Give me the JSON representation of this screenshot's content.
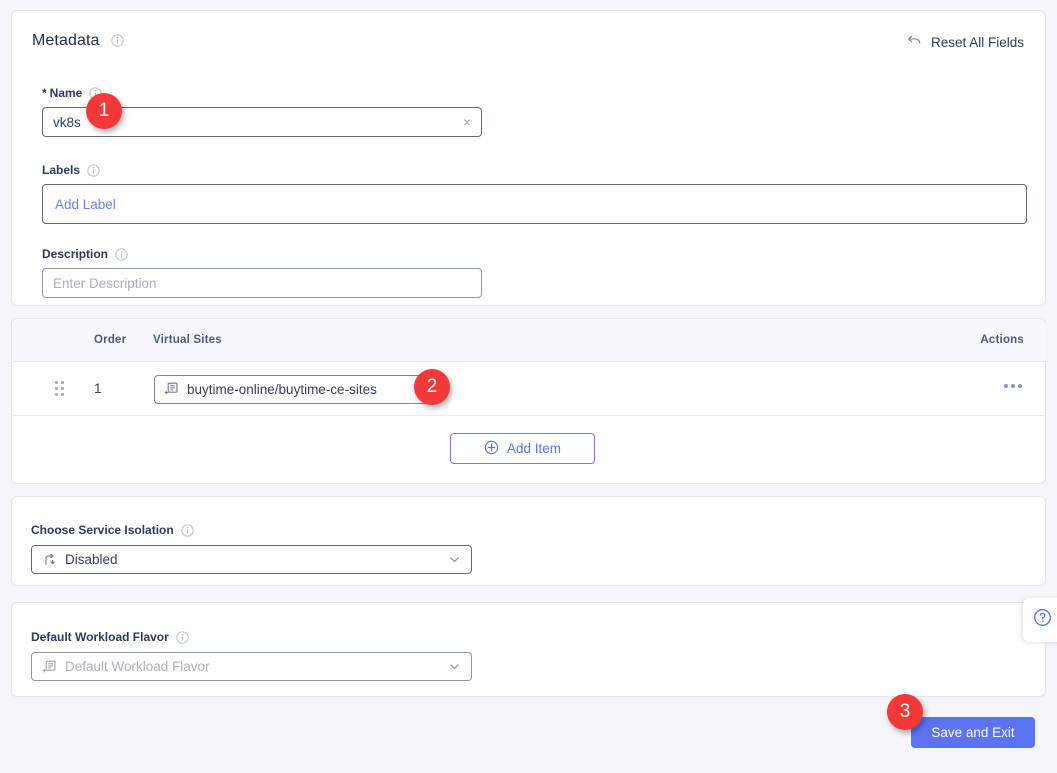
{
  "metadata_card": {
    "title": "Metadata",
    "reset_label": "Reset All Fields",
    "name_label": "Name",
    "name_required_mark": "*",
    "name_value": "vk8s",
    "name_clear_icon": "×",
    "labels_label": "Labels",
    "labels_add_text": "Add Label",
    "description_label": "Description",
    "description_placeholder": "Enter Description"
  },
  "sites_card": {
    "columns": [
      "Order",
      "Virtual Sites",
      "Actions"
    ],
    "rows": [
      {
        "order": "1",
        "virtual_site": "buytime-online/buytime-ce-sites"
      }
    ],
    "add_item_label": "Add Item"
  },
  "isolation_card": {
    "label": "Choose Service Isolation",
    "value": "Disabled"
  },
  "flavor_card": {
    "label": "Default Workload Flavor",
    "placeholder": "Default Workload Flavor"
  },
  "footer": {
    "save_label": "Save and Exit"
  },
  "help": {
    "icon": "question-mark-circle"
  },
  "annotations": [
    {
      "number": "1",
      "target": "name-input"
    },
    {
      "number": "2",
      "target": "virtual-site-chip"
    },
    {
      "number": "3",
      "target": "save-and-exit-button"
    }
  ],
  "colors": {
    "accent": "#5b72f2",
    "badge": "#f43838",
    "page_bg": "#f5f6f9",
    "card_bg": "#ffffff",
    "text": "#2c3d63"
  }
}
